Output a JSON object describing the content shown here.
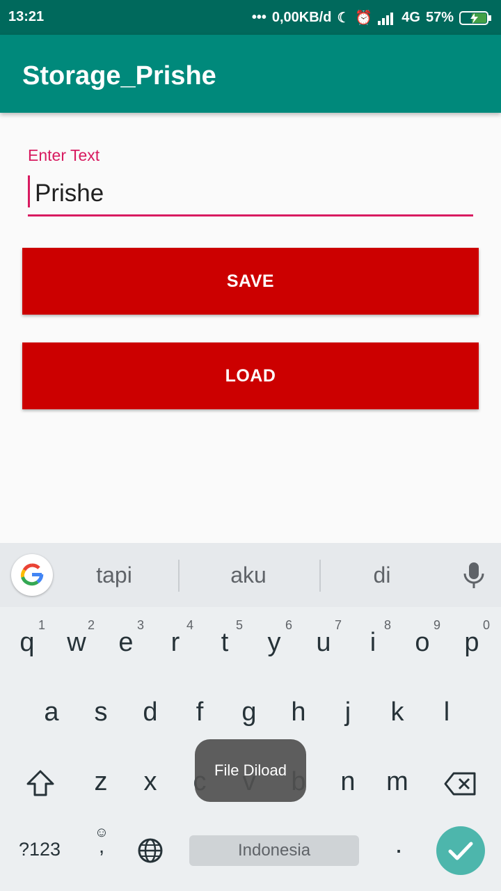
{
  "status": {
    "time": "13:21",
    "net": "0,00KB/d",
    "signal": "4G",
    "battery": "57%"
  },
  "app": {
    "title": "Storage_Prishe"
  },
  "form": {
    "label": "Enter Text",
    "value": "Prishe"
  },
  "buttons": {
    "save": "SAVE",
    "load": "LOAD"
  },
  "keyboard": {
    "suggestions": [
      "tapi",
      "aku",
      "di"
    ],
    "row1": [
      "q",
      "w",
      "e",
      "r",
      "t",
      "y",
      "u",
      "i",
      "o",
      "p"
    ],
    "row1_hints": [
      "1",
      "2",
      "3",
      "4",
      "5",
      "6",
      "7",
      "8",
      "9",
      "0"
    ],
    "row2": [
      "a",
      "s",
      "d",
      "f",
      "g",
      "h",
      "j",
      "k",
      "l"
    ],
    "row3": [
      "z",
      "x",
      "c",
      "v",
      "b",
      "n",
      "m"
    ],
    "sym": "?123",
    "comma": ",",
    "space": "Indonesia",
    "period": "."
  },
  "toast": "File Diload",
  "colors": {
    "primary": "#00897b",
    "primary_dark": "#00695c",
    "accent": "#d81b60",
    "button": "#cc0000"
  }
}
